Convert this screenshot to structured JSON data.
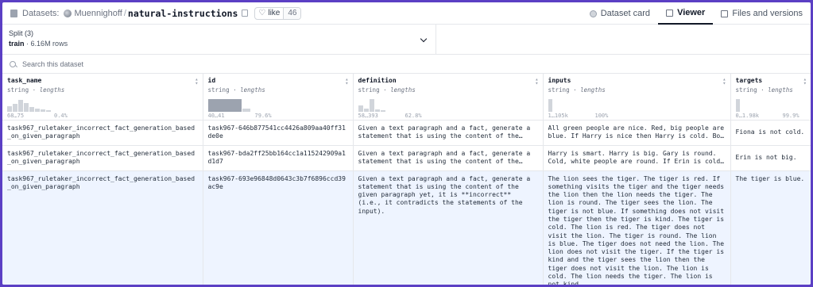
{
  "header": {
    "datasets_label": "Datasets:",
    "org": "Muennighoff",
    "separator": "/",
    "repo": "natural-instructions",
    "like_label": "like",
    "like_count": "46",
    "tabs": [
      {
        "label": "Dataset card",
        "icon": "dataset-card-icon"
      },
      {
        "label": "Viewer",
        "icon": "table-icon"
      },
      {
        "label": "Files and versions",
        "icon": "files-icon"
      }
    ]
  },
  "split": {
    "title": "Split (3)",
    "value": "train",
    "separator": "·",
    "rows": "6.16M rows"
  },
  "search": {
    "placeholder": "Search this dataset"
  },
  "columns": [
    {
      "name": "task_name",
      "type": "string",
      "stat": "lengths",
      "min_max": "68…75",
      "pct": "0.4%"
    },
    {
      "name": "id",
      "type": "string",
      "stat": "lengths",
      "min_max": "40…41",
      "pct": "79.6%"
    },
    {
      "name": "definition",
      "type": "string",
      "stat": "lengths",
      "min_max": "58…393",
      "pct": "62.8%"
    },
    {
      "name": "inputs",
      "type": "string",
      "stat": "lengths",
      "min_max": "1…105k",
      "pct": "100%"
    },
    {
      "name": "targets",
      "type": "string",
      "stat": "lengths",
      "min_max": "0…1.98k",
      "pct": "99.9%"
    }
  ],
  "rows": [
    {
      "task_name": "task967_ruletaker_incorrect_fact_generation_based_on_given_paragraph",
      "id": "task967-646b877541cc4426a809aa40ff31de0e",
      "definition": "Given a text paragraph and a fact, generate a statement that is using the content of the given paragraph yet, it is **incorrect** (i.e., it contradicts the statements of the input).",
      "inputs": "All green people are nice. Red, big people are blue. If Harry is nice then Harry is cold. Bob is big.",
      "targets": "Fiona is not cold."
    },
    {
      "task_name": "task967_ruletaker_incorrect_fact_generation_based_on_given_paragraph",
      "id": "task967-bda2ff25bb164cc1a115242909a1d1d7",
      "definition": "Given a text paragraph and a fact, generate a statement that is using the content of the given paragraph yet, it is **incorrect** (i.e., it contradicts the statements of the input).",
      "inputs": "Harry is smart. Harry is big. Gary is round. Cold, white people are round. If Erin is cold then Erin is big.",
      "targets": "Erin is not big."
    },
    {
      "task_name": "task967_ruletaker_incorrect_fact_generation_based_on_given_paragraph",
      "id": "task967-693e96848d0643c3b7f6896ccd39ac9e",
      "definition": "Given a text paragraph and a fact, generate a statement that is using the content of the given paragraph yet, it is **incorrect** (i.e., it contradicts the statements of the input).",
      "inputs": "The lion sees the tiger. The tiger is red. If something visits the tiger and the tiger needs the lion then the lion needs the tiger. The lion is round. The tiger sees the lion. The tiger is not blue. If something does not visit the tiger then the tiger is kind. The tiger is cold. The lion is red. The tiger does not visit the lion. The tiger is round. The lion is blue. The tiger does not need the lion. The lion does not visit the tiger. If the tiger is kind and the tiger sees the lion then the tiger does not visit the lion. The lion is cold. The lion needs the tiger. The lion is not kind.",
      "targets": "The tiger is blue."
    }
  ]
}
